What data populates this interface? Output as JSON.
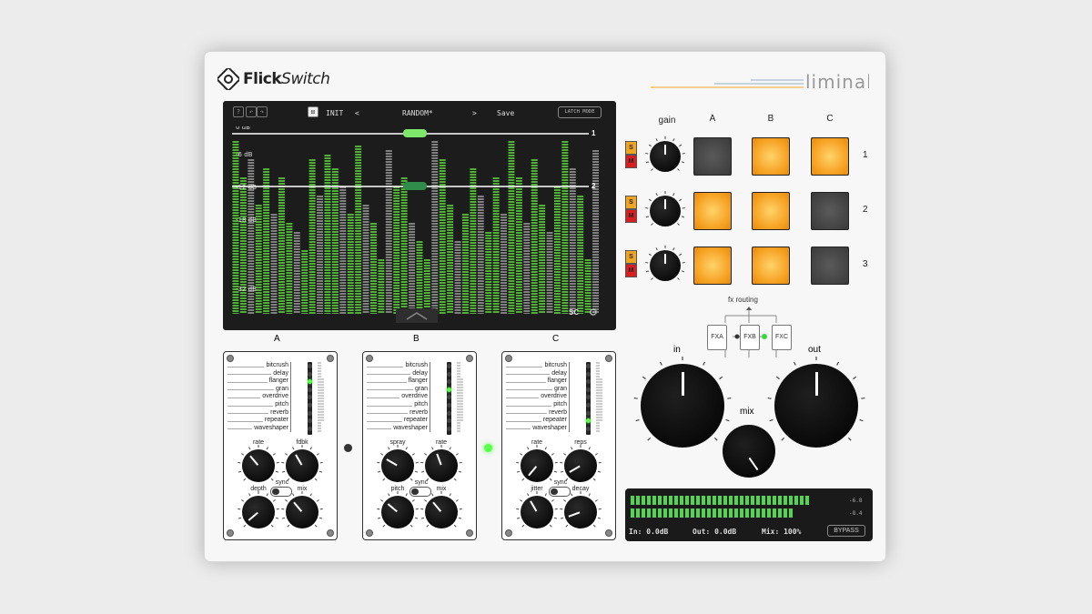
{
  "brand": {
    "logo_text_a": "Flick",
    "logo_text_b": "Switch",
    "liminal": "liminal",
    "accent_orange": "#f6a323",
    "accent_green": "#5aff4a"
  },
  "display": {
    "help_icon": "?",
    "init": "INIT",
    "prev": "<",
    "preset": "RANDOM*",
    "next": ">",
    "save": "Save",
    "latch": "LATCH MODE",
    "db_labels": [
      "0 dB",
      "-6 dB",
      "-12 dB",
      "-18 dB",
      "-32 dB"
    ],
    "lane_labels": [
      "1",
      "2"
    ],
    "sc": "SC",
    "gear_icon": "gear-icon"
  },
  "mixer": {
    "gain_label": "gain",
    "columns": [
      "A",
      "B",
      "C"
    ],
    "rows": [
      "1",
      "2",
      "3"
    ],
    "solo": "S",
    "mute": "M",
    "pads": [
      [
        "off",
        "on",
        "on"
      ],
      [
        "on",
        "on",
        "off"
      ],
      [
        "on",
        "on",
        "off"
      ]
    ],
    "routing_label": "fx routing",
    "fx": [
      "FXA",
      "FXB",
      "FXC"
    ]
  },
  "modules": [
    {
      "title": "A",
      "effects": [
        "bitcrush",
        "delay",
        "flanger",
        "gran",
        "overdrive",
        "pitch",
        "reverb",
        "repeater",
        "waveshaper"
      ],
      "active": 2,
      "k1": "rate",
      "k2": "fdbk",
      "k3": "depth",
      "k4": "mix",
      "sync": "sync"
    },
    {
      "title": "B",
      "effects": [
        "bitcrush",
        "delay",
        "flanger",
        "gran",
        "overdrive",
        "pitch",
        "reverb",
        "repeater",
        "waveshaper"
      ],
      "active": 3,
      "k1": "spray",
      "k2": "rate",
      "k3": "pitch",
      "k4": "mix",
      "sync": "sync"
    },
    {
      "title": "C",
      "effects": [
        "bitcrush",
        "delay",
        "flanger",
        "gran",
        "overdrive",
        "pitch",
        "reverb",
        "repeater",
        "waveshaper"
      ],
      "active": 7,
      "k1": "rate",
      "k2": "reps",
      "k3": "jitter",
      "k4": "decay",
      "sync": "sync"
    }
  ],
  "master": {
    "in": "in",
    "out": "out",
    "mix": "mix"
  },
  "meter": {
    "l_val": "-6.8",
    "r_val": "-8.4",
    "in_text": "In: 0.0dB",
    "out_text": "Out: 0.0dB",
    "mix_text": "Mix: 100%",
    "bypass": "BYPASS"
  }
}
